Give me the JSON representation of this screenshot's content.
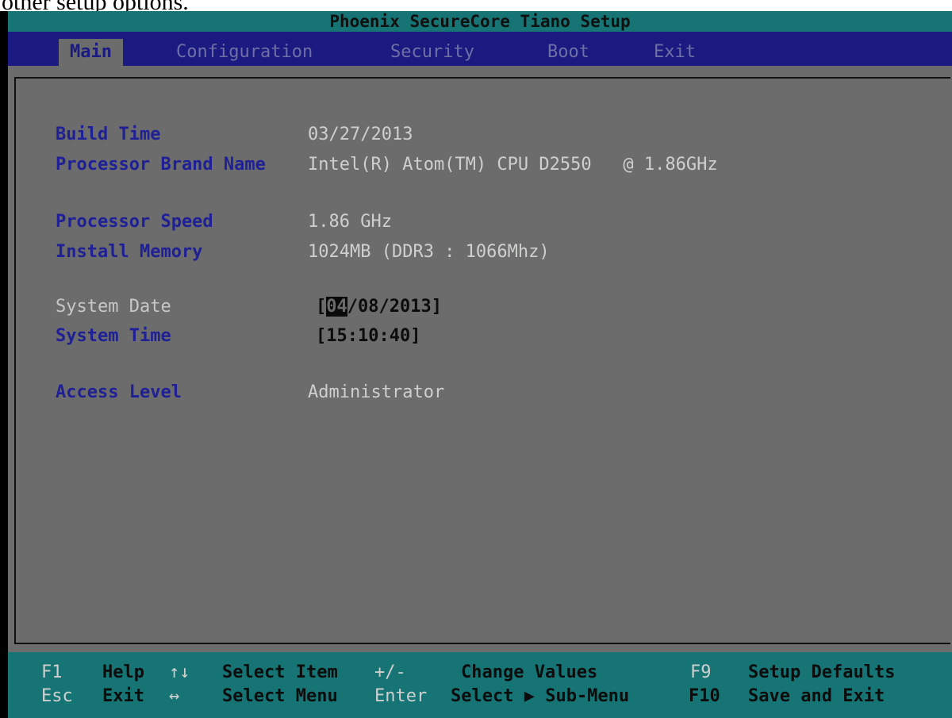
{
  "caption": "other setup options.",
  "title": "Phoenix SecureCore Tiano Setup",
  "menu": [
    "Main",
    "Configuration",
    "Security",
    "Boot",
    "Exit"
  ],
  "main": {
    "build_time": {
      "label": "Build Time",
      "value": "03/27/2013"
    },
    "processor_brand": {
      "label": "Processor Brand Name",
      "value": "Intel(R) Atom(TM) CPU D2550   @ 1.86GHz"
    },
    "processor_speed": {
      "label": "Processor Speed",
      "value": "1.86 GHz"
    },
    "install_memory": {
      "label": "Install Memory",
      "value": "1024MB (DDR3 : 1066Mhz)"
    },
    "system_date": {
      "label": "System Date",
      "open": "[",
      "month": "04",
      "rest": "/08/2013]"
    },
    "system_time": {
      "label": "System Time",
      "value": "[15:10:40]"
    },
    "access_level": {
      "label": "Access Level",
      "value": "Administrator"
    }
  },
  "footer": {
    "f1_key": "F1",
    "f1_text": "Help",
    "updown_key": "↑↓",
    "updown_text": "Select Item",
    "plusminus_key": "+/-",
    "plusminus_text": "Change Values",
    "f9_key": "F9",
    "f9_text": "Setup Defaults",
    "esc_key": "Esc",
    "esc_text": "Exit",
    "leftright_key": "↔",
    "leftright_text": "Select Menu",
    "enter_key": "Enter",
    "enter_text": "Select ▶ Sub-Menu",
    "f10_key": "F10",
    "f10_text": "Save and Exit"
  }
}
